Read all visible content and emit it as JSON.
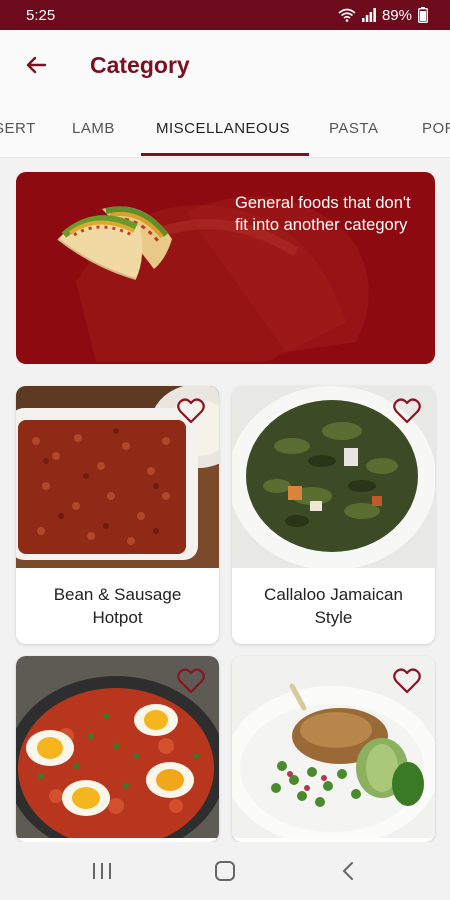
{
  "status_bar": {
    "time": "5:25",
    "battery": "89%"
  },
  "app_bar": {
    "title": "Category"
  },
  "tabs": [
    {
      "label": "SERT"
    },
    {
      "label": "LAMB"
    },
    {
      "label": "MISCELLANEOUS"
    },
    {
      "label": "PASTA"
    },
    {
      "label": "POR"
    }
  ],
  "banner": {
    "description": "General foods that don't fit into another category"
  },
  "meals": [
    {
      "name": "Bean & Sausage Hotpot"
    },
    {
      "name": "Callaloo Jamaican Style"
    },
    {
      "name": ""
    },
    {
      "name": ""
    }
  ],
  "colors": {
    "primary": "#7b1020",
    "status_bar": "#6d0a1c",
    "banner": "#8d0a10"
  }
}
